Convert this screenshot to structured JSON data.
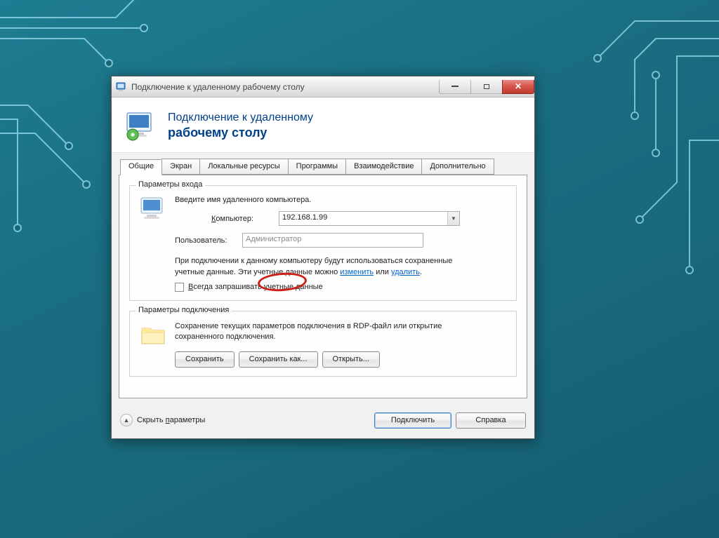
{
  "window": {
    "title": "Подключение к удаленному рабочему столу"
  },
  "header": {
    "line1": "Подключение к удаленному",
    "line2": "рабочему столу"
  },
  "tabs": [
    {
      "label": "Общие",
      "active": true
    },
    {
      "label": "Экран"
    },
    {
      "label": "Локальные ресурсы"
    },
    {
      "label": "Программы"
    },
    {
      "label": "Взаимодействие"
    },
    {
      "label": "Дополнительно"
    }
  ],
  "group_login": {
    "title": "Параметры входа",
    "intro": "Введите имя удаленного компьютера.",
    "computer_label_pre": "К",
    "computer_label_rest": "омпьютер:",
    "computer_value": "192.168.1.99",
    "user_label": "Пользователь:",
    "user_value": "Администратор",
    "note_part1": "При подключении к данному компьютеру будут использоваться сохраненные учетные данные. Эти учетные данные можно ",
    "note_link1": "изменить",
    "note_mid": " или ",
    "note_link2": "удалить",
    "note_end": ".",
    "checkbox_pre": "В",
    "checkbox_rest": "сегда запрашивать учетные данные"
  },
  "group_conn": {
    "title": "Параметры подключения",
    "text": "Сохранение текущих параметров подключения в RDP-файл или открытие сохраненного подключения.",
    "save": "Сохранить",
    "save_as": "Сохранить как...",
    "open": "Открыть..."
  },
  "footer": {
    "hide_pre": "Скрыть ",
    "hide_ul": "п",
    "hide_rest": "араметры",
    "connect": "Подключить",
    "help": "Справка"
  }
}
